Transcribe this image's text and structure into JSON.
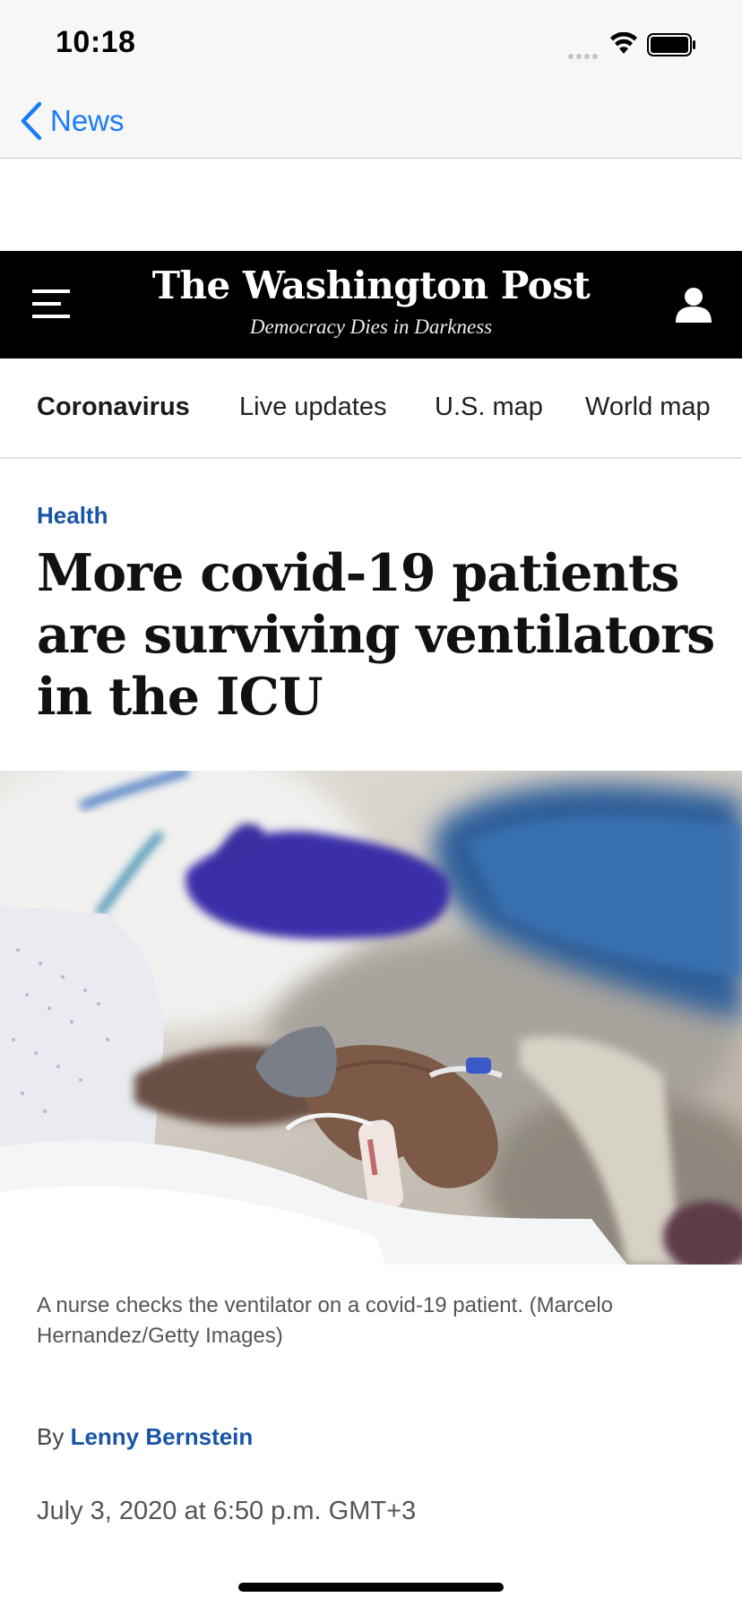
{
  "status_bar": {
    "time": "10:18"
  },
  "nav_bar": {
    "back_label": "News"
  },
  "masthead": {
    "title": "The Washington Post",
    "tagline": "Democracy Dies in Darkness"
  },
  "subnav": {
    "items": [
      {
        "label": "Coronavirus"
      },
      {
        "label": "Live updates"
      },
      {
        "label": "U.S. map"
      },
      {
        "label": "World map"
      }
    ]
  },
  "article": {
    "section": "Health",
    "headline": "More covid-19 patients are surviving ventilators in the ICU",
    "caption": "A nurse checks the ventilator on a covid-19 patient. (Marcelo Hernandez/Getty Images)",
    "byline_prefix": "By",
    "author": "Lenny Bernstein",
    "date": "July 3, 2020 at 6:50 p.m. GMT+3"
  },
  "colors": {
    "accent_blue": "#1955a5",
    "ios_link": "#1a7cf5",
    "header_bg": "#000000"
  }
}
